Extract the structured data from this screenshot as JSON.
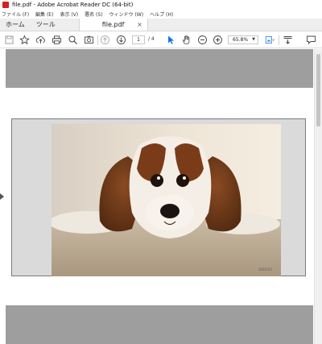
{
  "window": {
    "title": "file.pdf - Adobe Acrobat Reader DC (64-bit)"
  },
  "menu": {
    "items": [
      "ファイル (F)",
      "編集 (E)",
      "表示 (V)",
      "署名 (S)",
      "ウィンドウ (W)",
      "ヘルプ (H)"
    ]
  },
  "tabs": {
    "home": "ホーム",
    "tools": "ツール",
    "document": "file.pdf",
    "close": "×"
  },
  "toolbar": {
    "current_page": "1",
    "page_total": "/ 4",
    "zoom": "65.8%",
    "icons": [
      "save-icon",
      "star-icon",
      "upload-icon",
      "print-icon",
      "search-icon",
      "snapshot-icon",
      "page-up-icon",
      "page-down-icon",
      "select-cursor-icon",
      "hand-icon",
      "zoom-out-icon",
      "zoom-in-icon",
      "tools-icon",
      "scroll-mode-icon",
      "comment-icon"
    ]
  },
  "document": {
    "photo_caption": "2022/10"
  },
  "colors": {
    "acrobat_red": "#d71f1f",
    "active_blue": "#1473e6",
    "page_gray": "#9e9e9e"
  }
}
